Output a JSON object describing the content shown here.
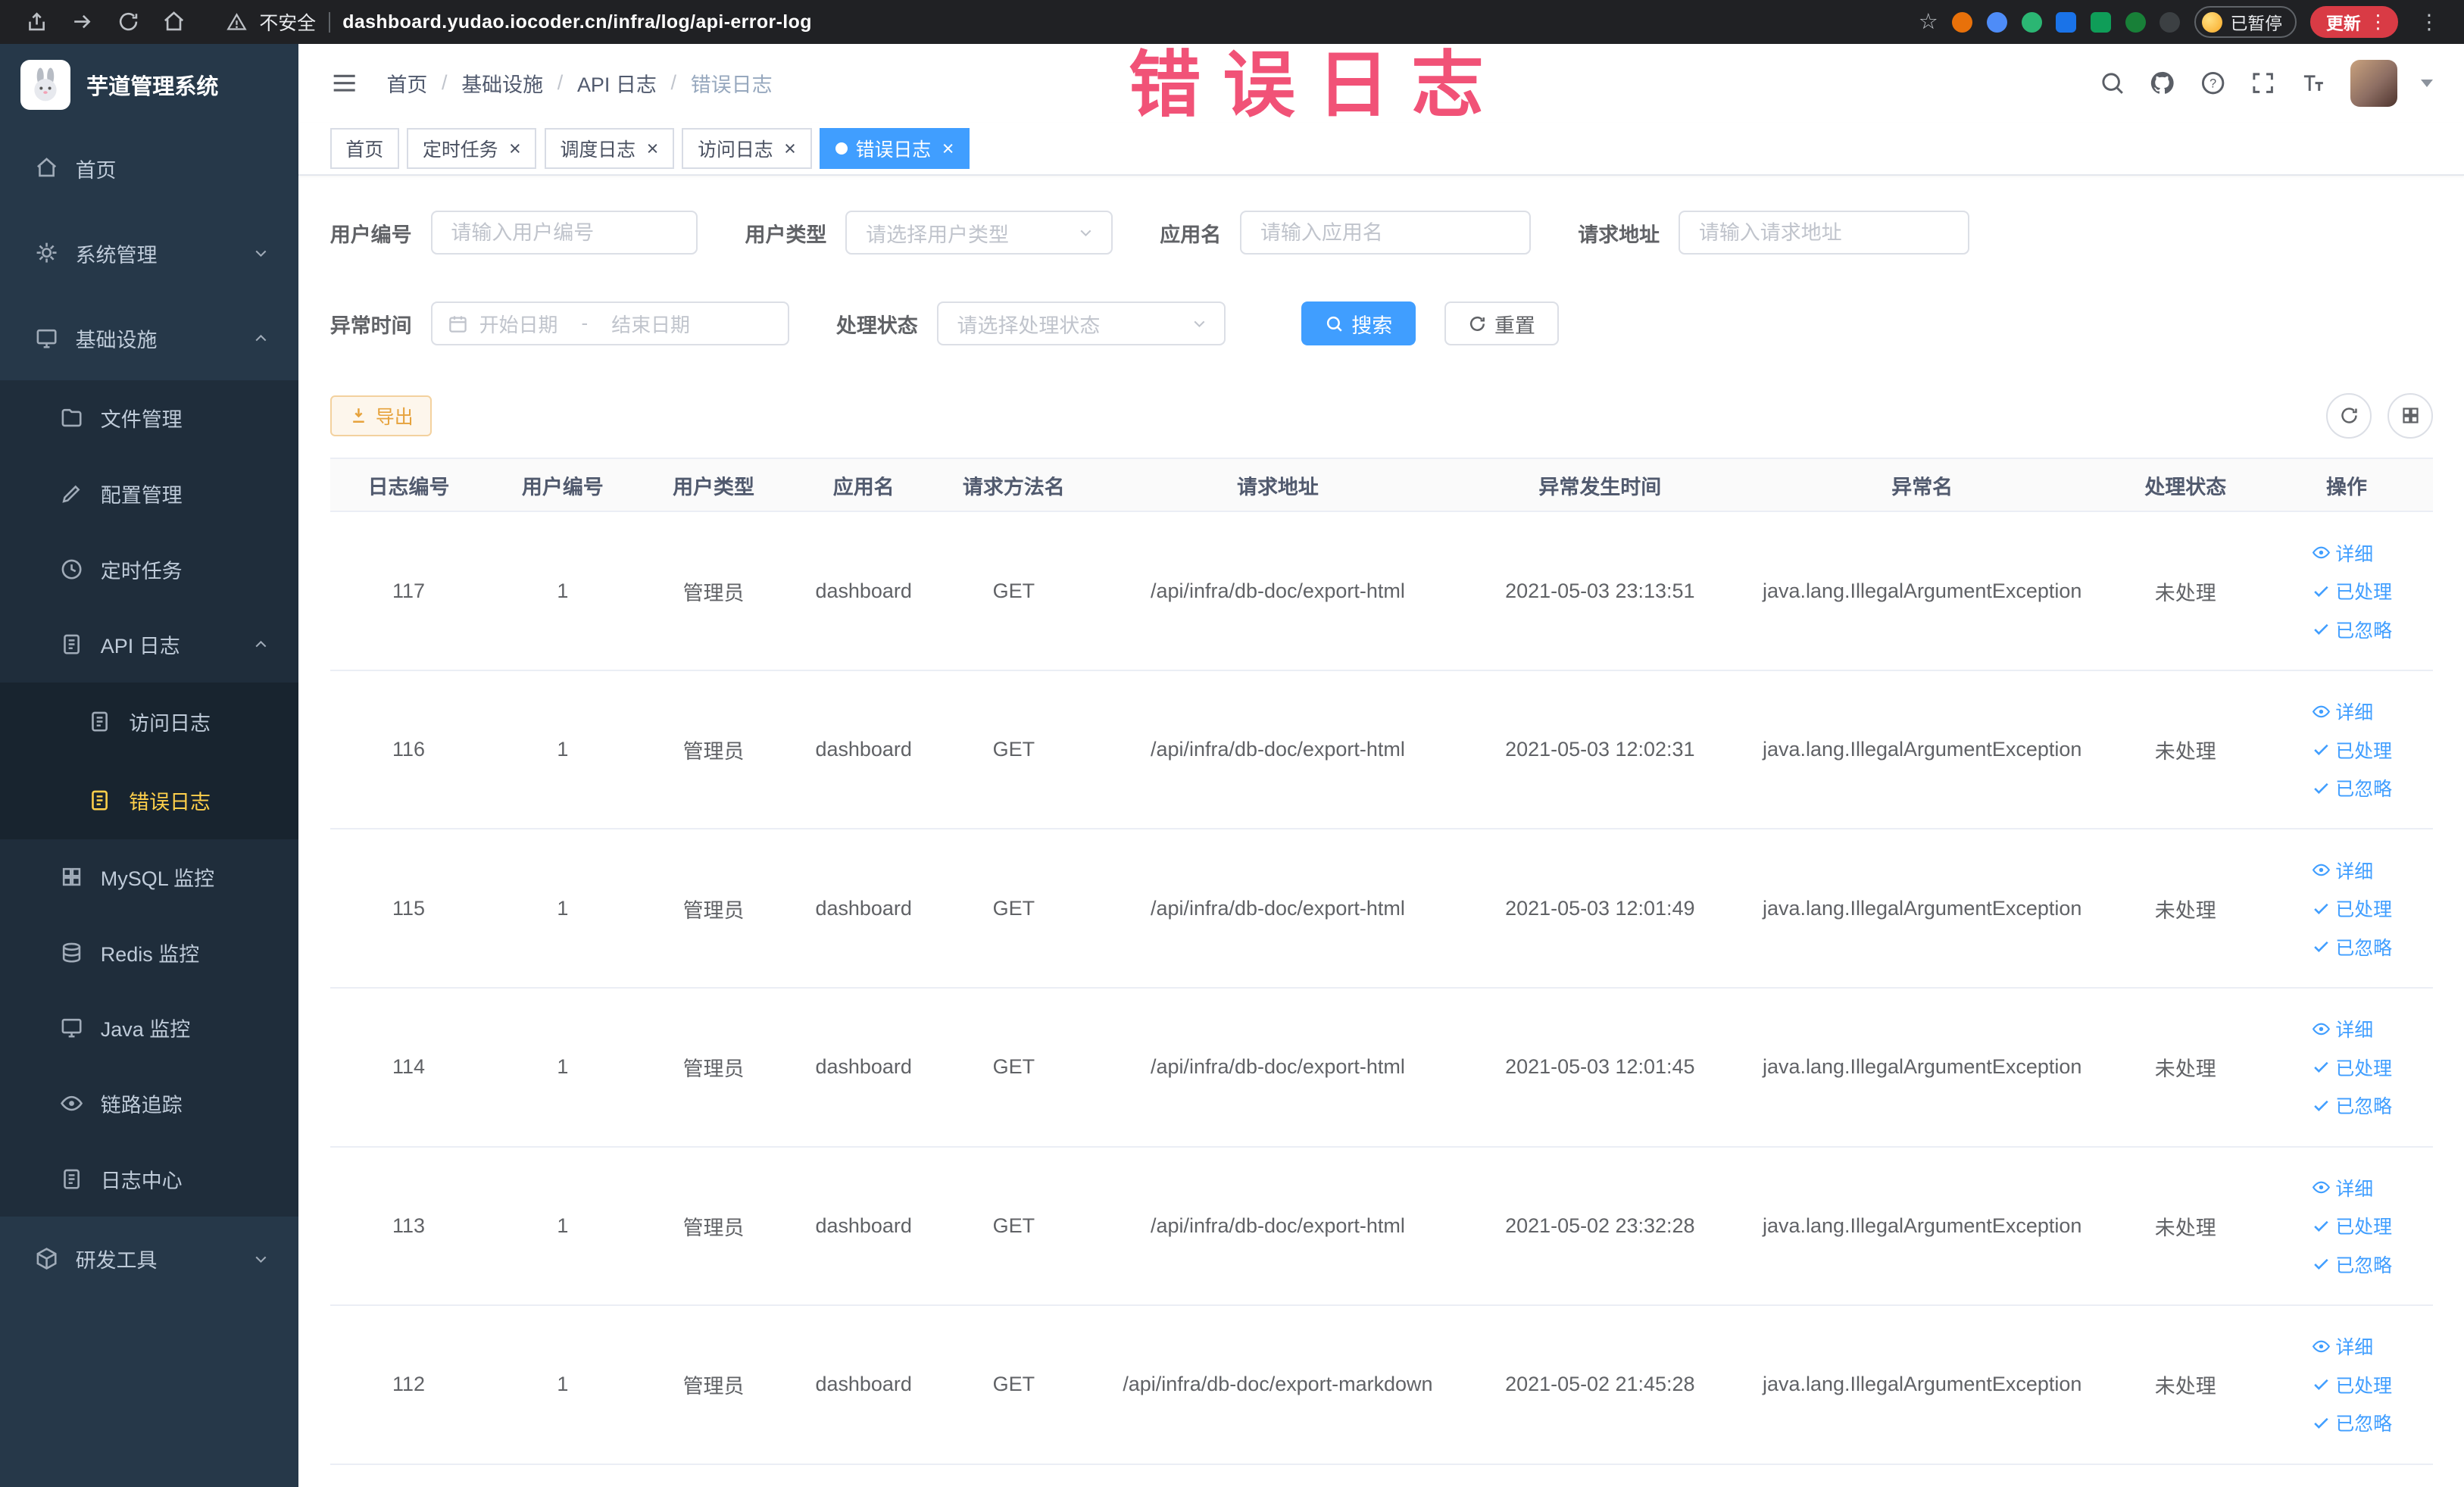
{
  "colors": {
    "accent": "#409eff",
    "warning": "#e6a23c",
    "sidebar_active": "#ffd04b",
    "overlay_text": "#f0446c"
  },
  "browser": {
    "security_label": "不安全",
    "url": "dashboard.yudao.iocoder.cn/infra/log/api-error-log",
    "paused_badge": "已暂停",
    "update_button": "更新"
  },
  "overlay": {
    "text": "错误日志"
  },
  "sidebar": {
    "title": "芋道管理系统",
    "items": [
      {
        "label": "首页",
        "icon": "home",
        "level": 1
      },
      {
        "label": "系统管理",
        "icon": "gear",
        "level": 1,
        "arrow": "down"
      },
      {
        "label": "基础设施",
        "icon": "monitor",
        "level": 1,
        "arrow": "up"
      },
      {
        "label": "文件管理",
        "icon": "folder",
        "level": 2
      },
      {
        "label": "配置管理",
        "icon": "edit",
        "level": 2
      },
      {
        "label": "定时任务",
        "icon": "clock",
        "level": 2
      },
      {
        "label": "API 日志",
        "icon": "doc",
        "level": 2,
        "arrow": "up"
      },
      {
        "label": "访问日志",
        "icon": "doc",
        "level": 3
      },
      {
        "label": "错误日志",
        "icon": "doc",
        "level": 3,
        "active": true
      },
      {
        "label": "MySQL 监控",
        "icon": "grid",
        "level": 2
      },
      {
        "label": "Redis 监控",
        "icon": "db",
        "level": 2
      },
      {
        "label": "Java 监控",
        "icon": "monitor",
        "level": 2
      },
      {
        "label": "链路追踪",
        "icon": "eye",
        "level": 2
      },
      {
        "label": "日志中心",
        "icon": "doc",
        "level": 2
      },
      {
        "label": "研发工具",
        "icon": "box",
        "level": 1,
        "arrow": "down"
      }
    ]
  },
  "header": {
    "breadcrumb": [
      "首页",
      "基础设施",
      "API 日志",
      "错误日志"
    ]
  },
  "tabs": [
    {
      "label": "首页",
      "closable": false,
      "active": false
    },
    {
      "label": "定时任务",
      "closable": true,
      "active": false
    },
    {
      "label": "调度日志",
      "closable": true,
      "active": false
    },
    {
      "label": "访问日志",
      "closable": true,
      "active": false
    },
    {
      "label": "错误日志",
      "closable": true,
      "active": true
    }
  ],
  "filters": {
    "user_id": {
      "label": "用户编号",
      "placeholder": "请输入用户编号"
    },
    "user_type": {
      "label": "用户类型",
      "placeholder": "请选择用户类型"
    },
    "app_name": {
      "label": "应用名",
      "placeholder": "请输入应用名"
    },
    "request_url": {
      "label": "请求地址",
      "placeholder": "请输入请求地址"
    },
    "exception_time": {
      "label": "异常时间",
      "start": "开始日期",
      "end": "结束日期",
      "separator": "-"
    },
    "status": {
      "label": "处理状态",
      "placeholder": "请选择处理状态"
    },
    "search": "搜索",
    "reset": "重置"
  },
  "toolbar": {
    "export_label": "导出"
  },
  "table": {
    "columns": [
      "日志编号",
      "用户编号",
      "用户类型",
      "应用名",
      "请求方法名",
      "请求地址",
      "异常发生时间",
      "异常名",
      "处理状态",
      "操作"
    ],
    "rows": [
      {
        "id": "117",
        "user_id": "1",
        "user_type": "管理员",
        "app": "dashboard",
        "method": "GET",
        "url": "/api/infra/db-doc/export-html",
        "time": "2021-05-03 23:13:51",
        "exception": "java.lang.IllegalArgumentException",
        "status": "未处理"
      },
      {
        "id": "116",
        "user_id": "1",
        "user_type": "管理员",
        "app": "dashboard",
        "method": "GET",
        "url": "/api/infra/db-doc/export-html",
        "time": "2021-05-03 12:02:31",
        "exception": "java.lang.IllegalArgumentException",
        "status": "未处理"
      },
      {
        "id": "115",
        "user_id": "1",
        "user_type": "管理员",
        "app": "dashboard",
        "method": "GET",
        "url": "/api/infra/db-doc/export-html",
        "time": "2021-05-03 12:01:49",
        "exception": "java.lang.IllegalArgumentException",
        "status": "未处理"
      },
      {
        "id": "114",
        "user_id": "1",
        "user_type": "管理员",
        "app": "dashboard",
        "method": "GET",
        "url": "/api/infra/db-doc/export-html",
        "time": "2021-05-03 12:01:45",
        "exception": "java.lang.IllegalArgumentException",
        "status": "未处理"
      },
      {
        "id": "113",
        "user_id": "1",
        "user_type": "管理员",
        "app": "dashboard",
        "method": "GET",
        "url": "/api/infra/db-doc/export-html",
        "time": "2021-05-02 23:32:28",
        "exception": "java.lang.IllegalArgumentException",
        "status": "未处理"
      },
      {
        "id": "112",
        "user_id": "1",
        "user_type": "管理员",
        "app": "dashboard",
        "method": "GET",
        "url": "/api/infra/db-doc/export-markdown",
        "time": "2021-05-02 21:45:28",
        "exception": "java.lang.IllegalArgumentException",
        "status": "未处理"
      }
    ],
    "actions": [
      {
        "label": "详细",
        "icon": "eye"
      },
      {
        "label": "已处理",
        "icon": "check"
      },
      {
        "label": "已忽略",
        "icon": "check"
      }
    ]
  }
}
